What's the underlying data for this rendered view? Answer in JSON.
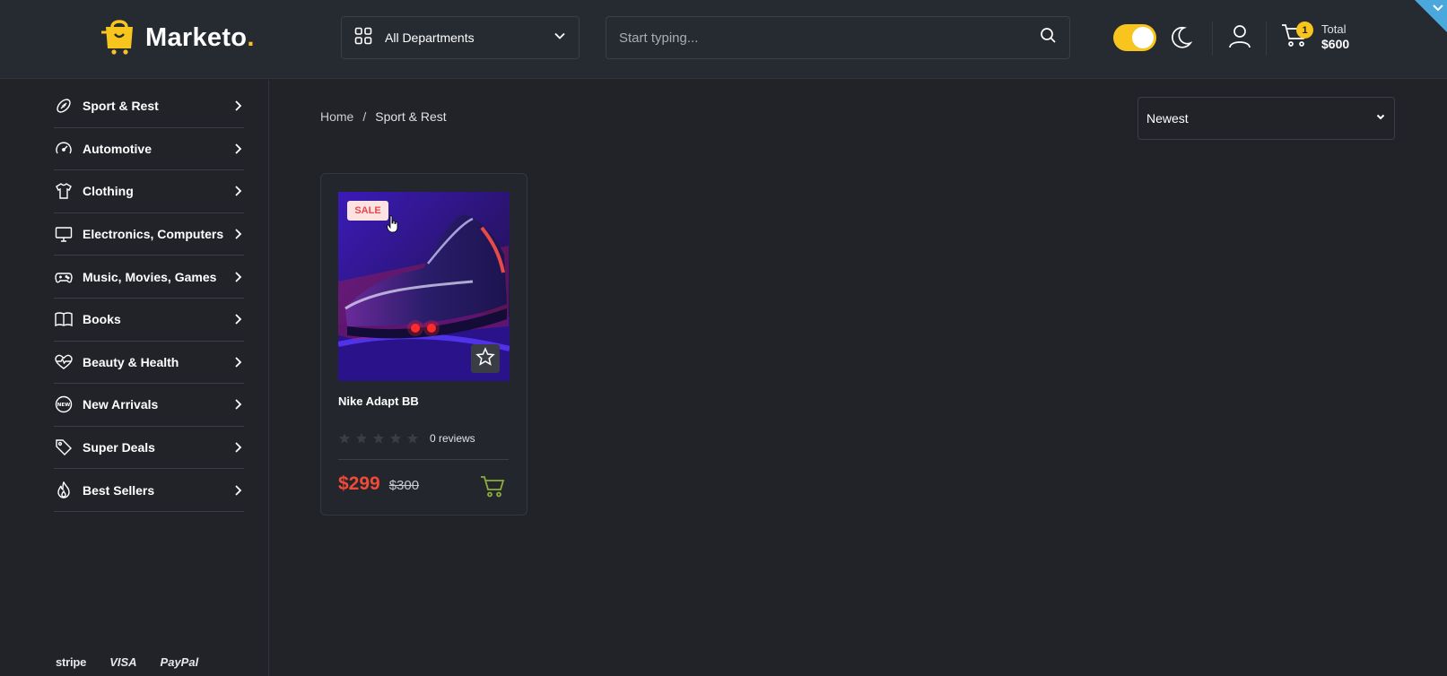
{
  "header": {
    "logo_text": "Marketo",
    "logo_dot": ".",
    "departments_label": "All Departments",
    "search_placeholder": "Start typing...",
    "cart_count": "1",
    "total_label": "Total",
    "total_value": "$600"
  },
  "colors": {
    "accent": "#f7c51e",
    "sale": "#ef4b38",
    "background": "#212328",
    "header": "#262a31"
  },
  "sidebar": {
    "categories": [
      {
        "label": "Sport & Rest",
        "icon": "football-icon"
      },
      {
        "label": "Automotive",
        "icon": "speedometer-icon"
      },
      {
        "label": "Clothing",
        "icon": "tshirt-icon"
      },
      {
        "label": "Electronics, Computers",
        "icon": "monitor-icon"
      },
      {
        "label": "Music, Movies, Games",
        "icon": "gamepad-icon"
      },
      {
        "label": "Books",
        "icon": "book-icon"
      },
      {
        "label": "Beauty & Health",
        "icon": "heart-pulse-icon"
      },
      {
        "label": "New Arrivals",
        "icon": "new-badge-icon"
      },
      {
        "label": "Super Deals",
        "icon": "tag-icon"
      },
      {
        "label": "Best Sellers",
        "icon": "flame-icon"
      }
    ],
    "payments": [
      "stripe",
      "VISA",
      "PayPal"
    ]
  },
  "breadcrumb": {
    "home": "Home",
    "separator": "/",
    "current": "Sport & Rest"
  },
  "sort": {
    "selected": "Newest"
  },
  "products": [
    {
      "title": "Nike Adapt BB",
      "badge": "SALE",
      "rating": 0,
      "reviews": "0 reviews",
      "price": "$299",
      "old_price": "$300"
    }
  ]
}
